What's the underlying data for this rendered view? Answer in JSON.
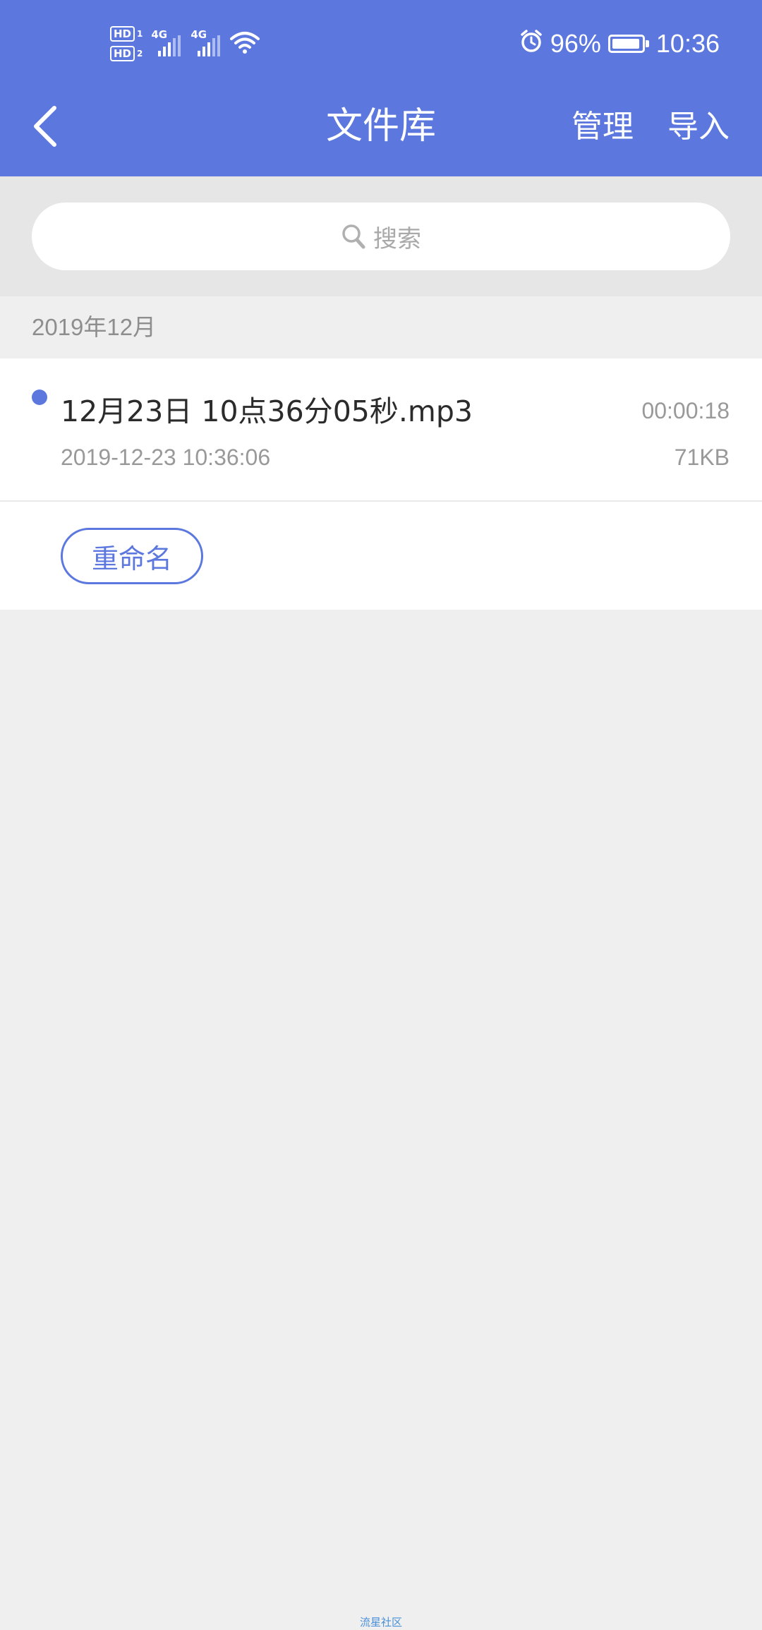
{
  "status_bar": {
    "sim1": {
      "label": "HD",
      "index": "1",
      "network": "4G"
    },
    "sim2": {
      "label": "HD",
      "index": "2",
      "network": "4G"
    },
    "battery_percent": "96%",
    "battery_level": 0.96,
    "time": "10:36",
    "icons": [
      "signal-icon",
      "wifi-icon",
      "alarm-icon",
      "battery-icon"
    ]
  },
  "header": {
    "title": "文件库",
    "manage_label": "管理",
    "import_label": "导入",
    "back_icon": "back-arrow-icon"
  },
  "search": {
    "placeholder": "搜索",
    "icon": "search-icon"
  },
  "section": {
    "title": "2019年12月"
  },
  "files": [
    {
      "name": "12月23日 10点36分05秒.mp3",
      "duration": "00:00:18",
      "datetime": "2019-12-23 10:36:06",
      "size": "71KB"
    }
  ],
  "actions": {
    "rename_label": "重命名"
  },
  "watermark": "流星社区",
  "colors": {
    "accent": "#5c78de",
    "background": "#efefef",
    "search_area": "#e6e6e6",
    "muted_text": "#999999"
  }
}
